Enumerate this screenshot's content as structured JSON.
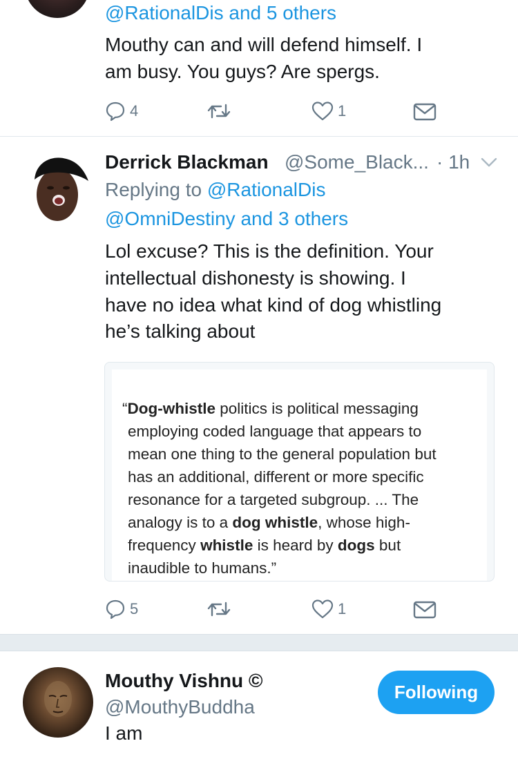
{
  "tweet1": {
    "reply_to_tail": "@RationalDis and 5 others",
    "text_line1": "Mouthy can and will defend himself. I",
    "text_line2": "am busy. You guys? Are spergs.",
    "replies": "4",
    "likes": "1"
  },
  "tweet2": {
    "display_name": "Derrick Blackman",
    "handle": "@Some_Black...",
    "dot_time": "· 1h",
    "replying_prefix": "Replying to ",
    "replying_user1": "@RationalDis",
    "replying_line2": "@OmniDestiny and 3 others",
    "text_lines": [
      "Lol excuse? This is the definition. Your",
      "intellectual dishonesty is showing. I",
      "have no idea what kind of dog whistling",
      "he’s talking about"
    ],
    "quote": {
      "l1a": "“",
      "l1b": "Dog-whistle",
      "l1c": " politics is political messaging",
      "l2": "employing coded language that appears to",
      "l3": "mean one thing to the general population but",
      "l4": "has an additional, different or more specific",
      "l5": "resonance for a targeted subgroup. ... The",
      "l6a": "analogy is to a ",
      "l6b": "dog whistle",
      "l6c": ", whose high-",
      "l7a": "frequency ",
      "l7b": "whistle",
      "l7c": " is heard by ",
      "l7d": "dogs",
      "l7e": " but",
      "l8": "inaudible to humans.”"
    },
    "replies": "5",
    "likes": "1"
  },
  "profile": {
    "display_name": "Mouthy Vishnu ©",
    "handle": "@MouthyBuddha",
    "bio": "I am",
    "follow_label": "Following"
  },
  "colors": {
    "link": "#1b95e0",
    "secondary": "#657786",
    "button": "#1da1f2",
    "divider": "#e1e8ed"
  },
  "icons": [
    "reply-icon",
    "retweet-icon",
    "like-icon",
    "dm-icon",
    "chevron-down-icon"
  ]
}
